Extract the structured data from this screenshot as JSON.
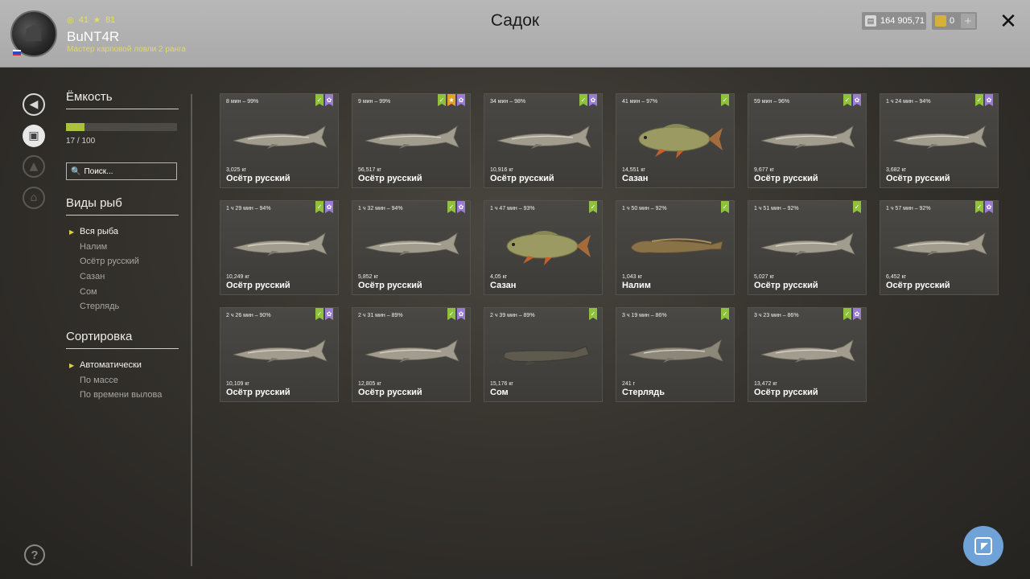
{
  "header": {
    "title": "Садок",
    "user": {
      "name": "BuNT4R",
      "rank": "Мастер карповой ловли 2 ранга",
      "level": "41",
      "stars": "81"
    },
    "silver": "164 905,71",
    "gold": "0",
    "plus_label": "+",
    "close_label": "✕"
  },
  "capacity": {
    "title": "Ёмкость",
    "count": "17 / 100",
    "fill": 0.17
  },
  "search": {
    "placeholder": "Поиск..."
  },
  "species": {
    "title": "Виды рыб",
    "items": [
      "Вся рыба",
      "Налим",
      "Осётр русский",
      "Сазан",
      "Сом",
      "Стерлядь"
    ]
  },
  "sort": {
    "title": "Сортировка",
    "items": [
      "Автоматически",
      "По массе",
      "По времени вылова"
    ]
  },
  "colors": {
    "accent_green": "#8fc13a",
    "badge_purple": "#9a7cd6",
    "badge_orange": "#e2a02a",
    "fab_blue": "#6fa3d8"
  },
  "fish": [
    {
      "time": "8 мин – 99%",
      "weight": "3,025 кг",
      "name": "Осётр русский",
      "kind": "sturgeon",
      "badges": [
        "green",
        "purple"
      ]
    },
    {
      "time": "9 мин – 99%",
      "weight": "56,517 кг",
      "name": "Осётр русский",
      "kind": "sturgeon",
      "badges": [
        "green",
        "orange",
        "purple"
      ]
    },
    {
      "time": "34 мин – 98%",
      "weight": "10,916 кг",
      "name": "Осётр русский",
      "kind": "sturgeon",
      "badges": [
        "green",
        "purple"
      ]
    },
    {
      "time": "41 мин – 97%",
      "weight": "14,551 кг",
      "name": "Сазан",
      "kind": "carp",
      "badges": [
        "green"
      ]
    },
    {
      "time": "59 мин – 96%",
      "weight": "9,677 кг",
      "name": "Осётр русский",
      "kind": "sturgeon",
      "badges": [
        "green",
        "purple"
      ]
    },
    {
      "time": "1 ч 24 мин – 94%",
      "weight": "3,682 кг",
      "name": "Осётр русский",
      "kind": "sturgeon",
      "badges": [
        "green",
        "purple"
      ]
    },
    {
      "time": "1 ч 29 мин – 94%",
      "weight": "10,249 кг",
      "name": "Осётр русский",
      "kind": "sturgeon",
      "badges": [
        "green",
        "purple"
      ]
    },
    {
      "time": "1 ч 32 мин – 94%",
      "weight": "5,852 кг",
      "name": "Осётр русский",
      "kind": "sturgeon",
      "badges": [
        "green",
        "purple"
      ]
    },
    {
      "time": "1 ч 47 мин – 93%",
      "weight": "4,05 кг",
      "name": "Сазан",
      "kind": "carp",
      "badges": [
        "green"
      ]
    },
    {
      "time": "1 ч 50 мин – 92%",
      "weight": "1,043 кг",
      "name": "Налим",
      "kind": "burbot",
      "badges": [
        "green"
      ]
    },
    {
      "time": "1 ч 51 мин – 92%",
      "weight": "5,027 кг",
      "name": "Осётр русский",
      "kind": "sturgeon",
      "badges": [
        "green"
      ]
    },
    {
      "time": "1 ч 57 мин – 92%",
      "weight": "6,452 кг",
      "name": "Осётр русский",
      "kind": "sturgeon",
      "badges": [
        "green",
        "purple"
      ]
    },
    {
      "time": "2 ч 26 мин – 90%",
      "weight": "10,109 кг",
      "name": "Осётр русский",
      "kind": "sturgeon",
      "badges": [
        "green",
        "purple"
      ]
    },
    {
      "time": "2 ч 31 мин – 89%",
      "weight": "12,805 кг",
      "name": "Осётр русский",
      "kind": "sturgeon",
      "badges": [
        "green",
        "purple"
      ]
    },
    {
      "time": "2 ч 39 мин – 89%",
      "weight": "15,176 кг",
      "name": "Сом",
      "kind": "catfish",
      "badges": [
        "green"
      ]
    },
    {
      "time": "3 ч 19 мин – 86%",
      "weight": "241 г",
      "name": "Стерлядь",
      "kind": "sterlet",
      "badges": [
        "green"
      ]
    },
    {
      "time": "3 ч 23 мин – 86%",
      "weight": "13,472 кг",
      "name": "Осётр русский",
      "kind": "sturgeon",
      "badges": [
        "green",
        "purple"
      ]
    }
  ],
  "help_label": "?"
}
